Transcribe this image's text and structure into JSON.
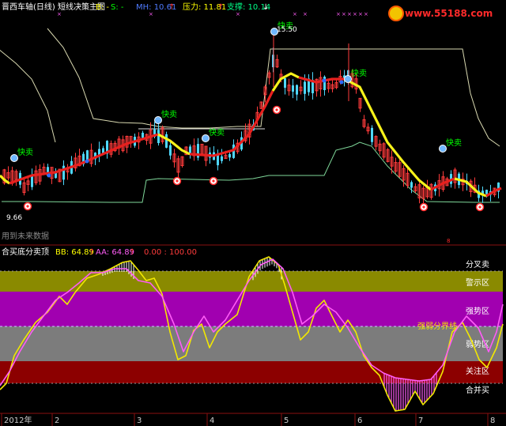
{
  "header": {
    "title": "晋西车轴(日线) 短线决策主图",
    "b_label": "B: -",
    "s_label": "S: -",
    "mh_label": "MH: 10.61",
    "pressure_label": "压力: 11.81",
    "support_label": "支撑: 10.14",
    "watermark_url": "www.55188.com"
  },
  "main_panel": {
    "note": "用到未来数据",
    "high_label": "15.50",
    "low_label": "9.66",
    "signal_sell_text": "快卖",
    "signal_buy_text": "买"
  },
  "indicator_panel": {
    "title": "合买底分卖顶",
    "bb_label": "BB: 64.89",
    "aa_label": "AA: 64.89",
    "range_label": "0.00 : 100.00",
    "zones": [
      "分叉卖",
      "警示区",
      "强势区",
      "强弱分界线",
      "弱势区",
      "关注区",
      "合并买"
    ]
  },
  "time_axis": {
    "labels": [
      "2012年",
      "2",
      "3",
      "4",
      "5",
      "6",
      "7",
      "8"
    ]
  },
  "colors": {
    "up": "#ff3b3b",
    "down": "#4fd8ff",
    "trend_red": "#e8201e",
    "trend_yellow": "#f7f21a",
    "bb_line": "#f2e800",
    "aa_line": "#ff5cf7",
    "zone_olive": "#8a8a00",
    "zone_purple": "#a100b0",
    "zone_gray": "#7c7c7c",
    "zone_red": "#8c0000"
  },
  "chart_data": [
    {
      "type": "candlestick",
      "title": "晋西车轴(日线) 短线决策主图",
      "x": [
        "2012年",
        "2",
        "3",
        "4",
        "5",
        "6",
        "7",
        "8"
      ],
      "ylim": [
        9.3,
        15.9
      ],
      "annotations": [
        "15.50",
        "9.66",
        "快卖",
        "用到未来数据"
      ],
      "series": [
        {
          "name": "B",
          "values": []
        },
        {
          "name": "S",
          "values": []
        },
        {
          "name": "MH",
          "values": [
            10.61
          ]
        },
        {
          "name": "压力",
          "values": [
            11.81
          ]
        },
        {
          "name": "支撑",
          "values": [
            10.14
          ]
        }
      ]
    },
    {
      "type": "line",
      "title": "合买底分卖顶",
      "ylim": [
        0,
        100
      ],
      "x": [
        "2012年",
        "2",
        "3",
        "4",
        "5",
        "6",
        "7",
        "8"
      ],
      "series": [
        {
          "name": "BB",
          "values": [
            64.89
          ]
        },
        {
          "name": "AA",
          "values": [
            64.89
          ]
        }
      ],
      "bands": [
        {
          "name": "分叉卖",
          "from": 90,
          "to": 100
        },
        {
          "name": "警示区",
          "from": 78,
          "to": 90
        },
        {
          "name": "强势区",
          "from": 50,
          "to": 78
        },
        {
          "name": "弱势区",
          "from": 22,
          "to": 50
        },
        {
          "name": "关注区",
          "from": 10,
          "to": 22
        }
      ]
    }
  ]
}
